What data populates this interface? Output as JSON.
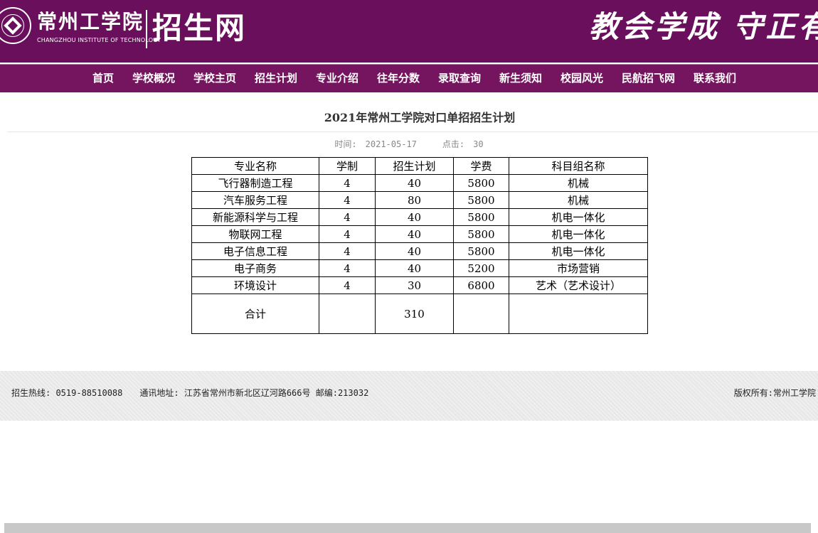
{
  "header": {
    "school_name_cn": "常州工学院",
    "school_name_en": "CHANGZHOU INSTITUTE OF TECHNOLOGY",
    "site_name": "招生网",
    "motto": "教会学成 守正有",
    "brand_color": "#6a0f5c"
  },
  "nav": {
    "items": [
      {
        "label": "首页"
      },
      {
        "label": "学校概况"
      },
      {
        "label": "学校主页"
      },
      {
        "label": "招生计划"
      },
      {
        "label": "专业介绍"
      },
      {
        "label": "往年分数"
      },
      {
        "label": "录取查询"
      },
      {
        "label": "新生须知"
      },
      {
        "label": "校园风光"
      },
      {
        "label": "民航招飞网"
      },
      {
        "label": "联系我们"
      }
    ]
  },
  "article": {
    "title": "2021年常州工学院对口单招招生计划",
    "time_label": "时间:",
    "time_value": "2021-05-17",
    "clicks_label": "点击:",
    "clicks_value": "30"
  },
  "table": {
    "headers": [
      "专业名称",
      "学制",
      "招生计划",
      "学费",
      "科目组名称"
    ],
    "rows": [
      [
        "飞行器制造工程",
        "4",
        "40",
        "5800",
        "机械"
      ],
      [
        "汽车服务工程",
        "4",
        "80",
        "5800",
        "机械"
      ],
      [
        "新能源科学与工程",
        "4",
        "40",
        "5800",
        "机电一体化"
      ],
      [
        "物联网工程",
        "4",
        "40",
        "5800",
        "机电一体化"
      ],
      [
        "电子信息工程",
        "4",
        "40",
        "5800",
        "机电一体化"
      ],
      [
        "电子商务",
        "4",
        "40",
        "5200",
        "市场营销"
      ],
      [
        "环境设计",
        "4",
        "30",
        "6800",
        "艺术（艺术设计）"
      ]
    ],
    "total": [
      "合计",
      "",
      "310",
      "",
      ""
    ]
  },
  "footer": {
    "hotline": "招生热线: 0519-88510088",
    "address": "通讯地址: 江苏省常州市新北区辽河路666号 邮编:213032",
    "copyright": "版权所有:常州工学院"
  }
}
